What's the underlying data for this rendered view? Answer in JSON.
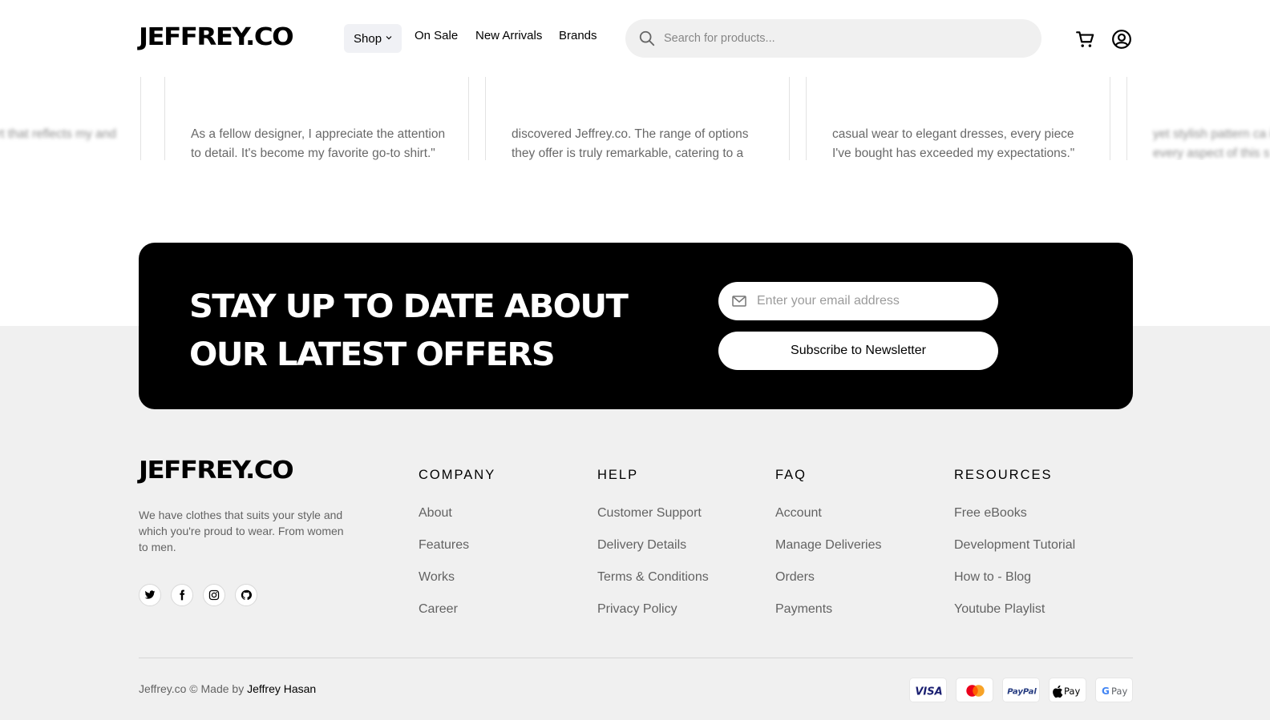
{
  "header": {
    "logo": "JEFFREY.CO",
    "nav": {
      "shop": "Shop",
      "on_sale": "On Sale",
      "new_arrivals": "New Arrivals",
      "brands": "Brands"
    },
    "search_placeholder": "Search for products..."
  },
  "reviews": [
    {
      "text": "the designer's skill. It's art that reflects my and fashion.\""
    },
    {
      "text": "As a fellow designer, I appreciate the attention to detail. It's become my favorite go-to shirt.\""
    },
    {
      "text": "discovered Jeffrey.co. The range of options they offer is truly remarkable, catering to a variety of tastes and occasions.\""
    },
    {
      "text": "casual wear to elegant dresses, every piece I've bought has exceeded my expectations.\""
    },
    {
      "text": "yet stylish pattern ca is perfect. I can see t every aspect of this s"
    }
  ],
  "newsletter": {
    "title_line1": "STAY UP TO DATE ABOUT",
    "title_line2": "OUR LATEST OFFERS",
    "email_placeholder": "Enter your email address",
    "button_label": "Subscribe to Newsletter"
  },
  "footer": {
    "logo": "JEFFREY.CO",
    "description": "We have clothes that suits your style and which you're proud to wear. From women to men.",
    "social_icons": [
      "twitter-icon",
      "facebook-icon",
      "instagram-icon",
      "github-icon"
    ],
    "columns": [
      {
        "title": "COMPANY",
        "links": [
          "About",
          "Features",
          "Works",
          "Career"
        ]
      },
      {
        "title": "HELP",
        "links": [
          "Customer Support",
          "Delivery Details",
          "Terms & Conditions",
          "Privacy Policy"
        ]
      },
      {
        "title": "FAQ",
        "links": [
          "Account",
          "Manage Deliveries",
          "Orders",
          "Payments"
        ]
      },
      {
        "title": "RESOURCES",
        "links": [
          "Free eBooks",
          "Development Tutorial",
          "How to - Blog",
          "Youtube Playlist"
        ]
      }
    ],
    "copyright_prefix": "Jeffrey.co © Made by",
    "copyright_author": "Jeffrey Hasan",
    "payment_methods": [
      "visa-icon",
      "mastercard-icon",
      "paypal-icon",
      "apple-pay-icon",
      "google-pay-icon"
    ],
    "payment_text": {
      "visa": "VISA",
      "paypal": "PayPal",
      "apple_pay": "Pay",
      "google_pay": "Pay"
    }
  },
  "colors": {
    "background": "#ffffff",
    "footer_bg": "#f0f0f0",
    "newsletter_bg": "#000000",
    "text_muted": "#666666"
  }
}
